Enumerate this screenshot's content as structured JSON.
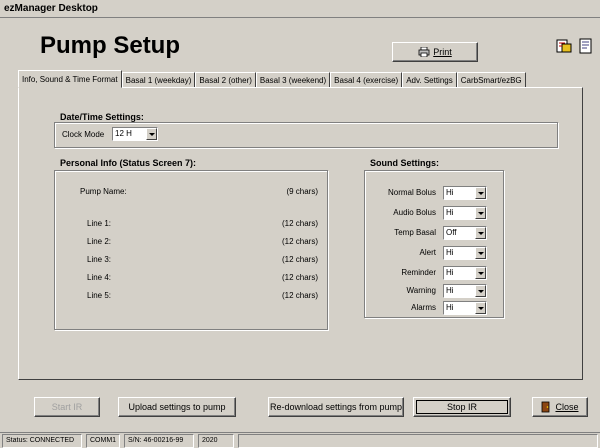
{
  "window": {
    "title": "ezManager Desktop"
  },
  "page": {
    "title": "Pump Setup"
  },
  "toolbar": {
    "print_label": "Print",
    "print_icon": "printer-icon"
  },
  "tabs": [
    {
      "label": "Info, Sound & Time Format",
      "active": true
    },
    {
      "label": "Basal 1 (weekday)"
    },
    {
      "label": "Basal 2 (other)"
    },
    {
      "label": "Basal 3 (weekend)"
    },
    {
      "label": "Basal 4 (exercise)"
    },
    {
      "label": "Adv. Settings"
    },
    {
      "label": "CarbSmart/ezBG"
    }
  ],
  "datetime": {
    "title": "Date/Time Settings:",
    "clock_mode_label": "Clock Mode",
    "clock_mode_value": "12 H"
  },
  "personal": {
    "title": "Personal Info (Status Screen 7):",
    "pump_name_label": "Pump Name:",
    "pump_name_hint": "(9 chars)",
    "lines": [
      {
        "label": "Line 1:",
        "hint": "(12 chars)"
      },
      {
        "label": "Line 2:",
        "hint": "(12 chars)"
      },
      {
        "label": "Line 3:",
        "hint": "(12 chars)"
      },
      {
        "label": "Line 4:",
        "hint": "(12 chars)"
      },
      {
        "label": "Line 5:",
        "hint": "(12 chars)"
      }
    ]
  },
  "sound": {
    "title": "Sound Settings:",
    "items": [
      {
        "label": "Normal Bolus",
        "value": "Hi"
      },
      {
        "label": "Audio Bolus",
        "value": "Hi"
      },
      {
        "label": "Temp Basal",
        "value": "Off"
      },
      {
        "label": "Alert",
        "value": "Hi"
      },
      {
        "label": "Reminder",
        "value": "Hi"
      },
      {
        "label": "Warning",
        "value": "Hi"
      },
      {
        "label": "Alarms",
        "value": "Hi"
      }
    ]
  },
  "buttons": {
    "start_ir": "Start IR",
    "upload": "Upload settings to pump",
    "redownload": "Re-download settings from pump",
    "stop_ir": "Stop IR",
    "close": "Close"
  },
  "status": {
    "connection": "Status: CONNECTED",
    "port": "COMM1",
    "serial": "S/N: 46-00216-99",
    "model": "2020"
  }
}
